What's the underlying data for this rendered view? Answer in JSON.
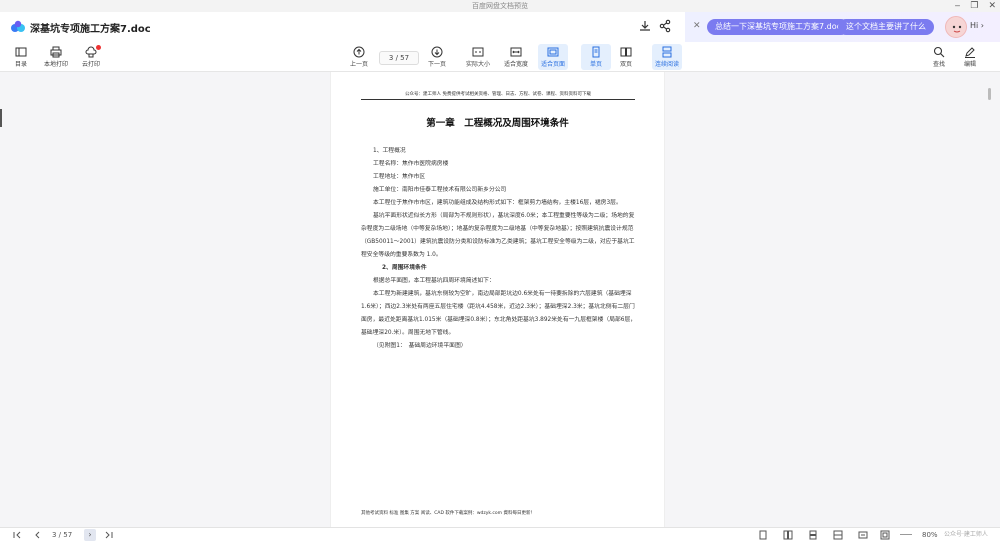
{
  "window": {
    "title": "百度网盘文档预览",
    "controls": [
      "‒",
      "❐",
      "✕"
    ]
  },
  "header": {
    "doc_title": "深基坑专项施工方案7.doc",
    "icons": [
      "download-icon",
      "share-icon"
    ]
  },
  "ai": {
    "close": "✕",
    "chip1": "总结一下深基坑专项施工方案7.doc",
    "chip2": "这个文档主要讲了什么",
    "greeting": "Hi",
    "chevron": "›"
  },
  "toolbar": {
    "left": [
      {
        "label": "目录",
        "icon": "outline-icon"
      },
      {
        "label": "本地打印",
        "icon": "print-icon"
      },
      {
        "label": "云打印",
        "icon": "cloud-print-icon"
      }
    ],
    "prev_label": "上一页",
    "next_label": "下一页",
    "page_indicator": "3 / 57",
    "view": [
      {
        "label": "实际大小",
        "icon": "actual-size-icon"
      },
      {
        "label": "适合宽度",
        "icon": "fit-width-icon"
      },
      {
        "label": "适合页面",
        "icon": "fit-page-icon"
      },
      {
        "label": "单页",
        "icon": "single-page-icon"
      },
      {
        "label": "双页",
        "icon": "double-page-icon"
      },
      {
        "label": "连续阅读",
        "icon": "continuous-icon"
      }
    ],
    "right": [
      {
        "label": "查找",
        "icon": "search-icon"
      },
      {
        "label": "编辑",
        "icon": "edit-icon"
      }
    ]
  },
  "page": {
    "header_line": "公众号：建工师人 免费提供考试相关资格、管理、日志、方程、试卷、课程、资料资料可下载",
    "chapter_title": "第一章　工程概况及周围环境条件",
    "section1": "1、工程概况",
    "project_name": "工程名称：焦作市医院病房楼",
    "project_location": "工程地址：焦作市区",
    "builder": "施工单位：南阳市佳泰工程技术有限公司新乡分公司",
    "para1": "本工程位于焦作市市区，建筑功能组成及结构形式如下：框架剪力墙结构，主楼16层，裙房3层。",
    "para2": "基坑平面形状近似长方形（局部为不规则形状），基坑深度6.0米；本工程重要性等级为二级；场地的复杂程度为二级场地（中等复杂场地）；地基的复杂程度为二级地基（中等复杂地基）；按照建筑抗震设计规范（GB50011～2001）建筑抗震设防分类和设防标准为乙类建筑；基坑工程安全等级为二级，对应于基坑工程安全等级的重要系数为 1.0。",
    "section2": "2、周围环境条件",
    "para3": "根据总平面图，本工程基坑四周环境简述如下：",
    "para4": "本工程为新建建筑，基坑东侧较为空旷，南边局部距坑边0.6米处有一待要拆除的六层建筑（基础埋深1.6米）；西边2.3米处有两座五层住宅楼（距坑4.458米，近边2.3米）；基础埋深2.3米；基坑北侧有二层门面房，最近处距离基坑1.015米（基础埋深0.8米）；东北角处距基坑3.892米处有一九层框架楼（局部6层，基础埋深20.米）。周围无地下管线。",
    "figure_ref": "（见附图1：　基础周边环境平面图）",
    "footer_line": "其他考试资料 标准 图集 方案 阅读、CAD 软件下载案例：wdzyk.com 資料每日更新！"
  },
  "status": {
    "page_indicator": "3 / 57",
    "zoom": "80%",
    "watermark": "公众号·建工师人"
  },
  "colors": {
    "accent": "#2a6fe0",
    "ai_chip": "#7b7bf0",
    "active_bg": "#e4effd"
  }
}
